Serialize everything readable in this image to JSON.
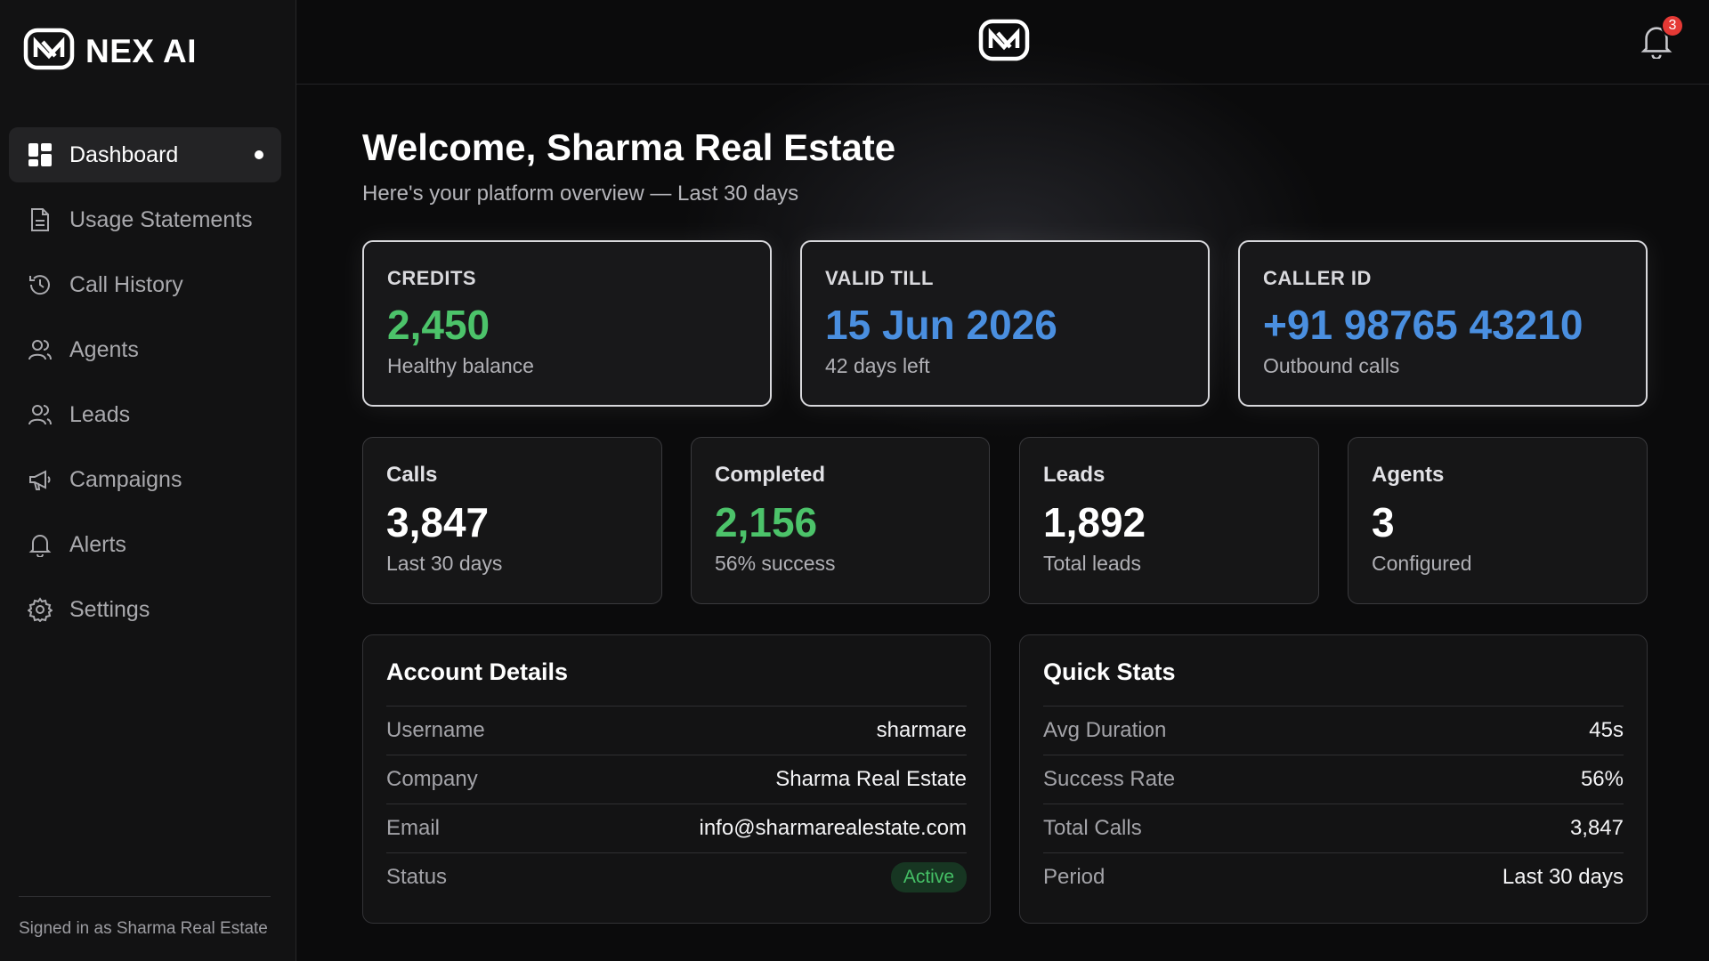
{
  "brand": {
    "name": "NEX AI"
  },
  "sidebar": {
    "items": [
      {
        "label": "Dashboard",
        "icon": "grid-icon",
        "active": true
      },
      {
        "label": "Usage Statements",
        "icon": "document-icon"
      },
      {
        "label": "Call History",
        "icon": "history-icon"
      },
      {
        "label": "Agents",
        "icon": "users-icon"
      },
      {
        "label": "Leads",
        "icon": "users-icon"
      },
      {
        "label": "Campaigns",
        "icon": "megaphone-icon"
      },
      {
        "label": "Alerts",
        "icon": "bell-icon"
      },
      {
        "label": "Settings",
        "icon": "gear-icon"
      }
    ],
    "signed_in": "Signed in as Sharma Real Estate"
  },
  "topbar": {
    "notification_count": "3"
  },
  "header": {
    "title": "Welcome, Sharma Real Estate",
    "subtitle": "Here's your platform overview — Last 30 days"
  },
  "highlight_cards": [
    {
      "label": "CREDITS",
      "value": "2,450",
      "sub": "Healthy balance",
      "color": "#4cc36a"
    },
    {
      "label": "VALID TILL",
      "value": "15 Jun 2026",
      "sub": "42 days left",
      "color": "#4a8fe0"
    },
    {
      "label": "CALLER ID",
      "value": "+91 98765 43210",
      "sub": "Outbound calls",
      "color": "#4a8fe0"
    }
  ],
  "stat_cards": [
    {
      "label": "Calls",
      "value": "3,847",
      "sub": "Last 30 days"
    },
    {
      "label": "Completed",
      "value": "2,156",
      "sub": "56% success"
    },
    {
      "label": "Leads",
      "value": "1,892",
      "sub": "Total leads"
    },
    {
      "label": "Agents",
      "value": "3",
      "sub": "Configured"
    }
  ],
  "account_details": {
    "title": "Account Details",
    "rows": [
      {
        "label": "Username",
        "value": "sharmare"
      },
      {
        "label": "Company",
        "value": "Sharma Real Estate"
      },
      {
        "label": "Email",
        "value": "info@sharmarealestate.com"
      },
      {
        "label": "Status",
        "value": "Active"
      }
    ]
  },
  "quick_stats": {
    "title": "Quick Stats",
    "rows": [
      {
        "label": "Avg Duration",
        "value": "45s"
      },
      {
        "label": "Success Rate",
        "value": "56%"
      },
      {
        "label": "Total Calls",
        "value": "3,847"
      },
      {
        "label": "Period",
        "value": "Last 30 days"
      }
    ]
  }
}
